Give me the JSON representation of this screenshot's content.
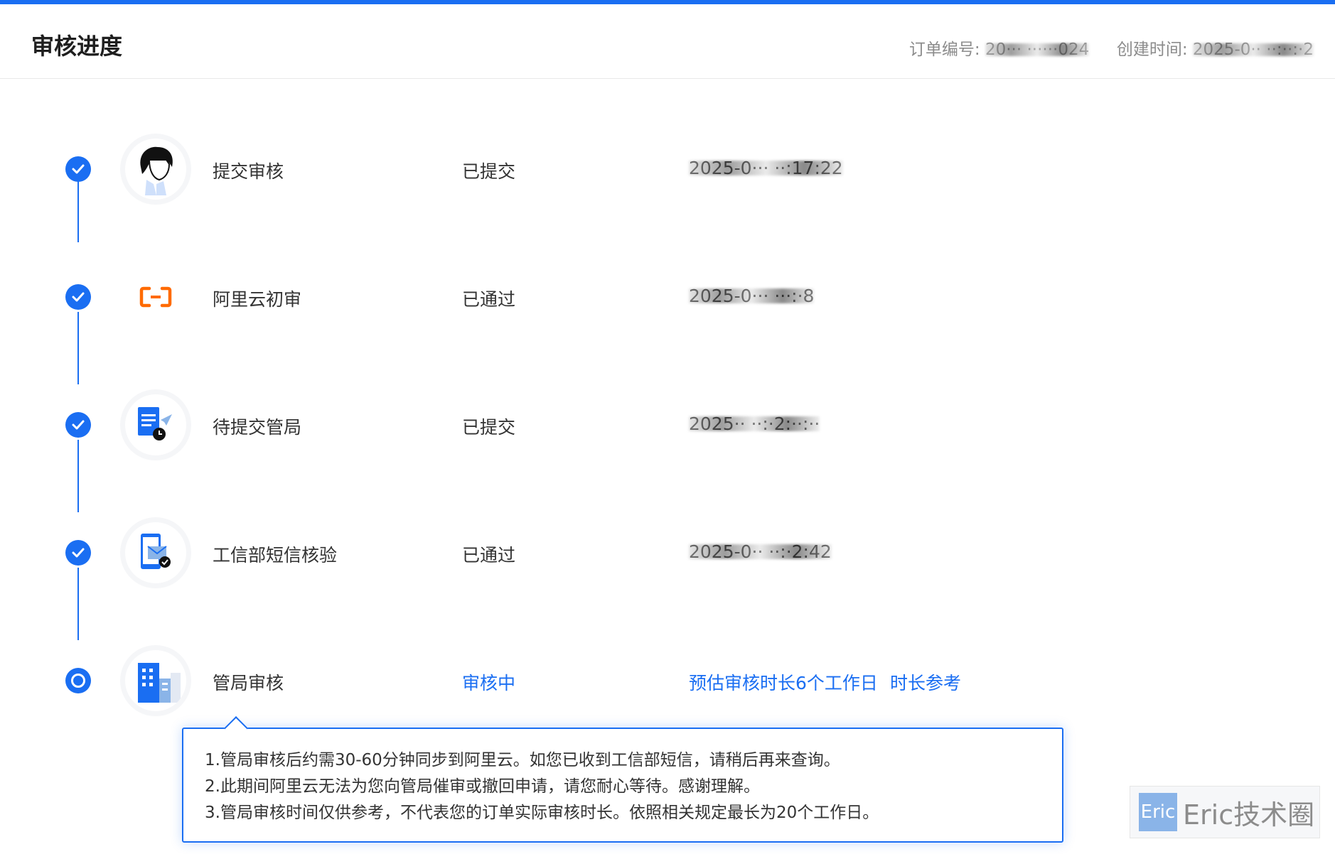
{
  "header": {
    "title": "审核进度",
    "order_label": "订单编号:",
    "order_value": "20··· ······024",
    "created_label": "创建时间:",
    "created_value": "2025-0·· ··:··:·2"
  },
  "steps": [
    {
      "name": "提交审核",
      "status": "已提交",
      "time": "2025-0··· ··:17:22",
      "icon": "user-avatar-icon"
    },
    {
      "name": "阿里云初审",
      "status": "已通过",
      "time": "2025-0··· ···:·8",
      "icon": "aliyun-logo-icon"
    },
    {
      "name": "待提交管局",
      "status": "已提交",
      "time": "2025·· ··:·2:··:··",
      "icon": "document-send-icon"
    },
    {
      "name": "工信部短信核验",
      "status": "已通过",
      "time": "2025-0·· ··:·2:42",
      "icon": "sms-verify-icon"
    },
    {
      "name": "管局审核",
      "status": "审核中",
      "note": "预估审核时长6个工作日",
      "link": "时长参考",
      "icon": "building-icon"
    }
  ],
  "tooltip": {
    "lines": [
      "1.管局审核后约需30-60分钟同步到阿里云。如您已收到工信部短信，请稍后再来查询。",
      "2.此期间阿里云无法为您向管局催审或撤回申请，请您耐心等待。感谢理解。",
      "3.管局审核时间仅供参考，不代表您的订单实际审核时长。依照相关规定最长为20个工作日。"
    ]
  },
  "watermark": {
    "badge": "Eric",
    "text": "Eric技术圈"
  },
  "colors": {
    "accent": "#1a6ef2",
    "aliyun_orange": "#ff6a00"
  }
}
